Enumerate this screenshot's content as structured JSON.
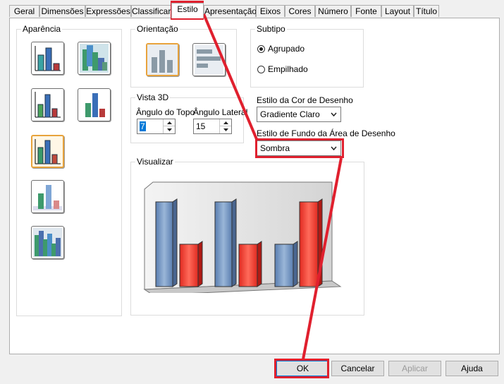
{
  "tabs": [
    {
      "label": "Geral",
      "active": false
    },
    {
      "label": "Dimensões",
      "active": false
    },
    {
      "label": "Expressões",
      "active": false
    },
    {
      "label": "Classificar",
      "active": false
    },
    {
      "label": "Estilo",
      "active": true
    },
    {
      "label": "Apresentação",
      "active": false
    },
    {
      "label": "Eixos",
      "active": false
    },
    {
      "label": "Cores",
      "active": false
    },
    {
      "label": "Número",
      "active": false
    },
    {
      "label": "Fonte",
      "active": false
    },
    {
      "label": "Layout",
      "active": false
    },
    {
      "label": "Título",
      "active": false
    }
  ],
  "appearance": {
    "label": "Aparência",
    "styles": [
      "bar-chart-flat",
      "bar-chart-3d",
      "bar-chart-framed",
      "bar-chart-tall",
      "bar-chart-glass-selected",
      "bar-chart-faded",
      "bar-chart-stacked"
    ]
  },
  "orientation": {
    "label": "Orientação",
    "options": [
      "vertical-bars-icon",
      "horizontal-bars-icon"
    ],
    "selected": "vertical"
  },
  "subtype": {
    "label": "Subtipo",
    "options": [
      {
        "label": "Agrupado",
        "checked": true
      },
      {
        "label": "Empilhado",
        "checked": false
      }
    ]
  },
  "view3d": {
    "label": "Vista 3D",
    "top_angle_label": "Ângulo do Topo",
    "top_angle_value": "7",
    "side_angle_label": "Ângulo Lateral",
    "side_angle_value": "15"
  },
  "plot_color_style": {
    "label": "Estilo da Cor de Desenho",
    "value": "Gradiente Claro"
  },
  "plot_area_bg": {
    "label": "Estilo de Fundo da Área de Desenho",
    "value": "Sombra"
  },
  "preview": {
    "label": "Visualizar"
  },
  "buttons": {
    "ok": "OK",
    "cancel": "Cancelar",
    "apply": "Aplicar",
    "help": "Ajuda"
  },
  "colors": {
    "highlight": "#e0202e",
    "blue_bar": "#6f8fba",
    "red_bar": "#ff3a2e",
    "selected_border": "#e8a33c"
  }
}
